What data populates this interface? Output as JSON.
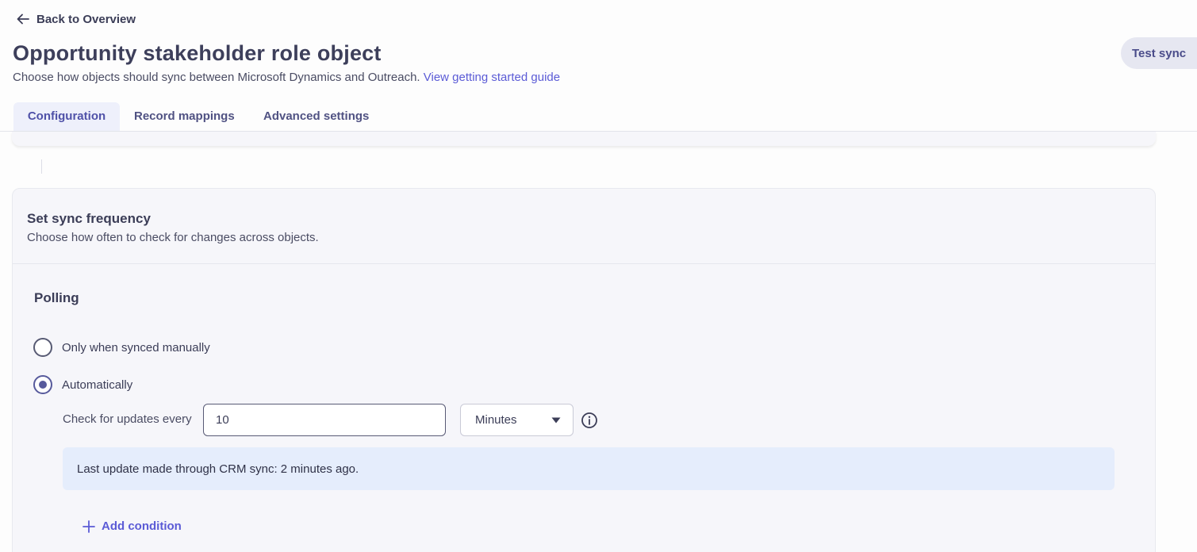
{
  "nav": {
    "back_label": "Back to Overview"
  },
  "header": {
    "title": "Opportunity stakeholder role object",
    "subtitle": "Choose how objects should sync between Microsoft Dynamics and Outreach.",
    "guide_link": "View getting started guide",
    "test_sync_label": "Test sync"
  },
  "tabs": [
    {
      "label": "Configuration",
      "active": true
    },
    {
      "label": "Record mappings",
      "active": false
    },
    {
      "label": "Advanced settings",
      "active": false
    }
  ],
  "sync_frequency": {
    "title": "Set sync frequency",
    "description": "Choose how often to check for changes across objects.",
    "section_title": "Polling",
    "options": [
      {
        "label": "Only when synced manually",
        "checked": false
      },
      {
        "label": "Automatically",
        "checked": true
      }
    ],
    "interval_label": "Check for updates every",
    "interval_value": "10",
    "interval_unit": "Minutes",
    "last_update_text": "Last update made through CRM sync: 2 minutes ago.",
    "add_condition_label": "Add condition"
  },
  "icons": {
    "back": "arrow-left-icon",
    "caret": "caret-down-icon",
    "info": "info-circle-icon",
    "add": "plus-icon"
  },
  "colors": {
    "accent": "#5b5bd6",
    "title": "#3d3f5b",
    "tab_active_bg": "#eef0fb",
    "banner_bg": "#e5edfc"
  }
}
